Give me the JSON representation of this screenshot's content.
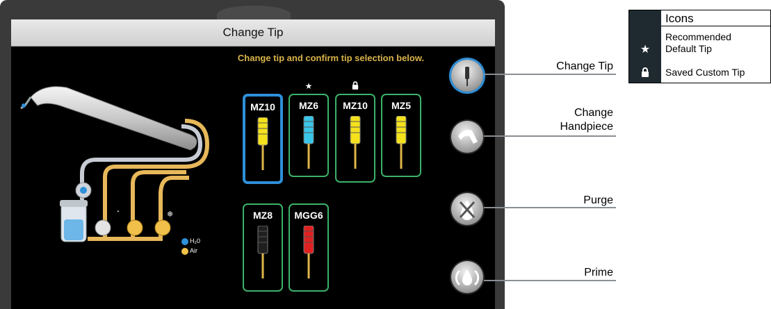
{
  "screen": {
    "title": "Change Tip",
    "instruction": "Change tip and confirm tip selection below."
  },
  "diagram_legend": {
    "water": "H₂0",
    "air": "Air"
  },
  "tips": [
    {
      "label": "MZ10",
      "color": "#f5e11c",
      "selected": true,
      "badge": ""
    },
    {
      "label": "MZ6",
      "color": "#39c6e8",
      "selected": false,
      "badge": "star-icon"
    },
    {
      "label": "MZ10",
      "color": "#f5e11c",
      "selected": false,
      "badge": "lock-icon"
    },
    {
      "label": "MZ5",
      "color": "#f5e11c",
      "selected": false,
      "badge": ""
    },
    {
      "label": "MZ8",
      "color": "#1f1f1f",
      "selected": false,
      "badge": ""
    },
    {
      "label": "MGG6",
      "color": "#e02020",
      "selected": false,
      "badge": ""
    }
  ],
  "side_buttons": [
    {
      "name": "change-tip",
      "label": "Change Tip",
      "icon": "tip-icon",
      "active": true
    },
    {
      "name": "change-handpiece",
      "label": "Change\nHandpiece",
      "icon": "handpiece-icon",
      "active": false
    },
    {
      "name": "purge",
      "label": "Purge",
      "icon": "purge-icon",
      "active": false
    },
    {
      "name": "prime",
      "label": "Prime",
      "icon": "droplet-icon",
      "active": false
    }
  ],
  "legend": {
    "title": "Icons",
    "items": [
      {
        "icon": "star-icon",
        "text": "Recommended\nDefault Tip"
      },
      {
        "icon": "lock-icon",
        "text": "Saved Custom Tip"
      }
    ]
  },
  "colors": {
    "tip_border": "#3cb36a",
    "selected_border": "#2f8fd8",
    "instruction": "#d9b34a",
    "water": "#2f8fd8",
    "air": "#f0c04a"
  }
}
